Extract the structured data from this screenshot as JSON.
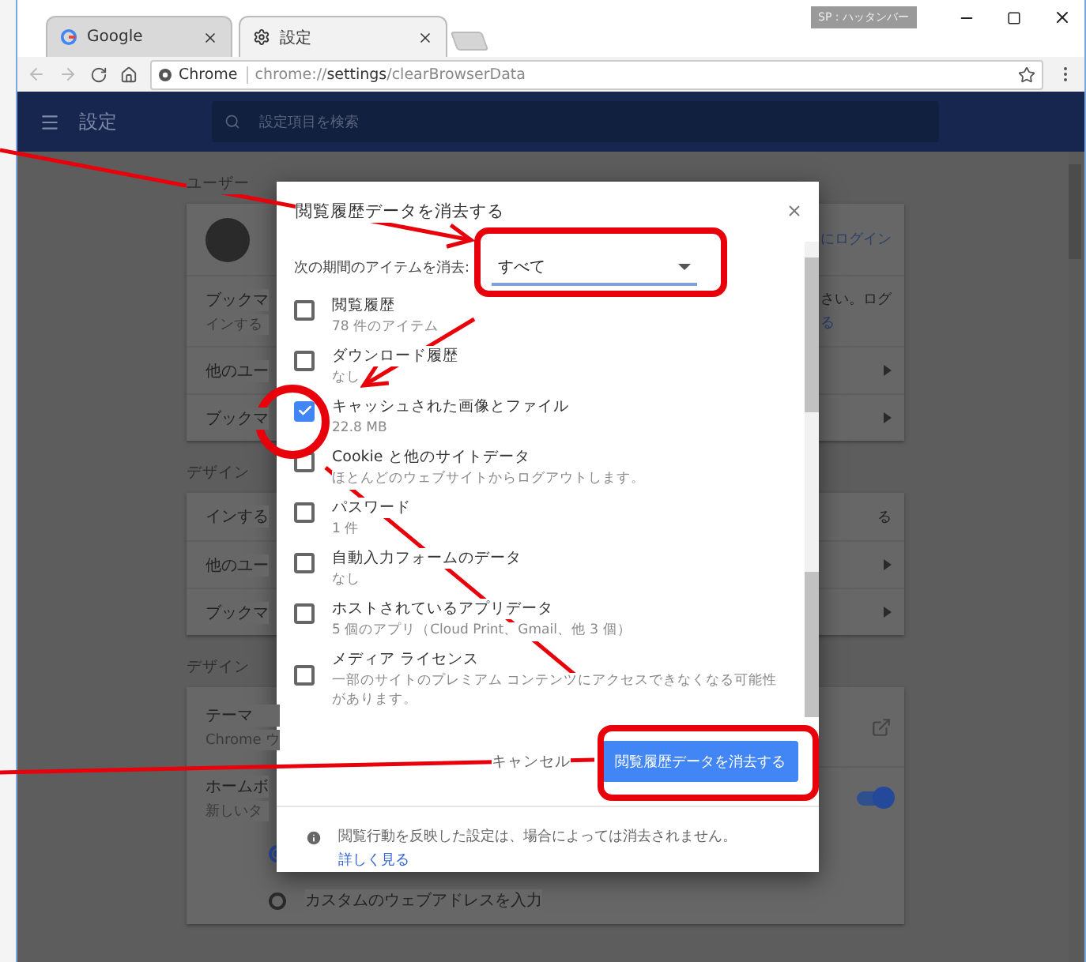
{
  "browser": {
    "tabs": [
      {
        "label": "Google",
        "selected": false
      },
      {
        "label": "設定",
        "selected": true
      }
    ],
    "profile_badge": "SP : ハッタンバー",
    "address": {
      "site": "Chrome",
      "url": "chrome://**settings**/clearBrowserData"
    }
  },
  "header": {
    "title": "設定",
    "search_placeholder": "設定項目を検索"
  },
  "sections": [
    {
      "label": "ユーザー",
      "rows": [
        {
          "kind": "avatar",
          "right_lines": [
            "にログイン"
          ]
        },
        {
          "kind": "text",
          "lines": [
            "ブックマ",
            "インする"
          ],
          "right_lines": [
            "さい。ログ",
            "る"
          ]
        },
        {
          "kind": "arrow",
          "lines": [
            "他のユー"
          ]
        },
        {
          "kind": "arrow",
          "lines": [
            "ブックマ"
          ]
        }
      ]
    },
    {
      "label": "デザイン",
      "rows": [
        {
          "kind": "text",
          "lines": [
            "インする"
          ],
          "right_lines": [
            "る"
          ]
        },
        {
          "kind": "arrow",
          "lines": [
            "他のユー"
          ]
        },
        {
          "kind": "arrow",
          "lines": [
            "ブックマ"
          ]
        }
      ]
    },
    {
      "label": "デザイン",
      "rows": [
        {
          "kind": "external",
          "lines": [
            "テーマ",
            "Chrome ウ"
          ]
        },
        {
          "kind": "toggle",
          "on": true,
          "lines": [
            "ホームボ",
            "新しいタ"
          ]
        },
        {
          "kind": "radio",
          "selected": true
        },
        {
          "kind": "radio",
          "selected": false,
          "lines": [
            "カスタムのウェブアドレスを入力"
          ]
        }
      ]
    }
  ],
  "dialog": {
    "title": "閲覧履歴データを消去する",
    "period_label": "次の期間のアイテムを消去:",
    "period_value": "すべて",
    "items": [
      {
        "title": "閲覧履歴",
        "detail": "78 件のアイテム",
        "checked": false
      },
      {
        "title": "ダウンロード履歴",
        "detail": "なし",
        "checked": false
      },
      {
        "title": "キャッシュされた画像とファイル",
        "detail": "22.8 MB",
        "checked": true
      },
      {
        "title": "Cookie と他のサイトデータ",
        "detail": "ほとんどのウェブサイトからログアウトします。",
        "checked": false
      },
      {
        "title": "パスワード",
        "detail": "1 件",
        "checked": false
      },
      {
        "title": "自動入力フォームのデータ",
        "detail": "なし",
        "checked": false
      },
      {
        "title": "ホストされているアプリデータ",
        "detail": "5 個のアプリ（Cloud Print、Gmail、他 3 個）",
        "checked": false
      },
      {
        "title": "メディア ライセンス",
        "detail": "一部のサイトのプレミアム コンテンツにアクセスできなくなる可能性があります。",
        "checked": false
      }
    ],
    "cancel": "キャンセル",
    "confirm": "閲覧履歴データを消去する",
    "note": "閲覧行動を反映した設定は、場合によっては消去されません。",
    "note_link": "詳しく見る"
  }
}
